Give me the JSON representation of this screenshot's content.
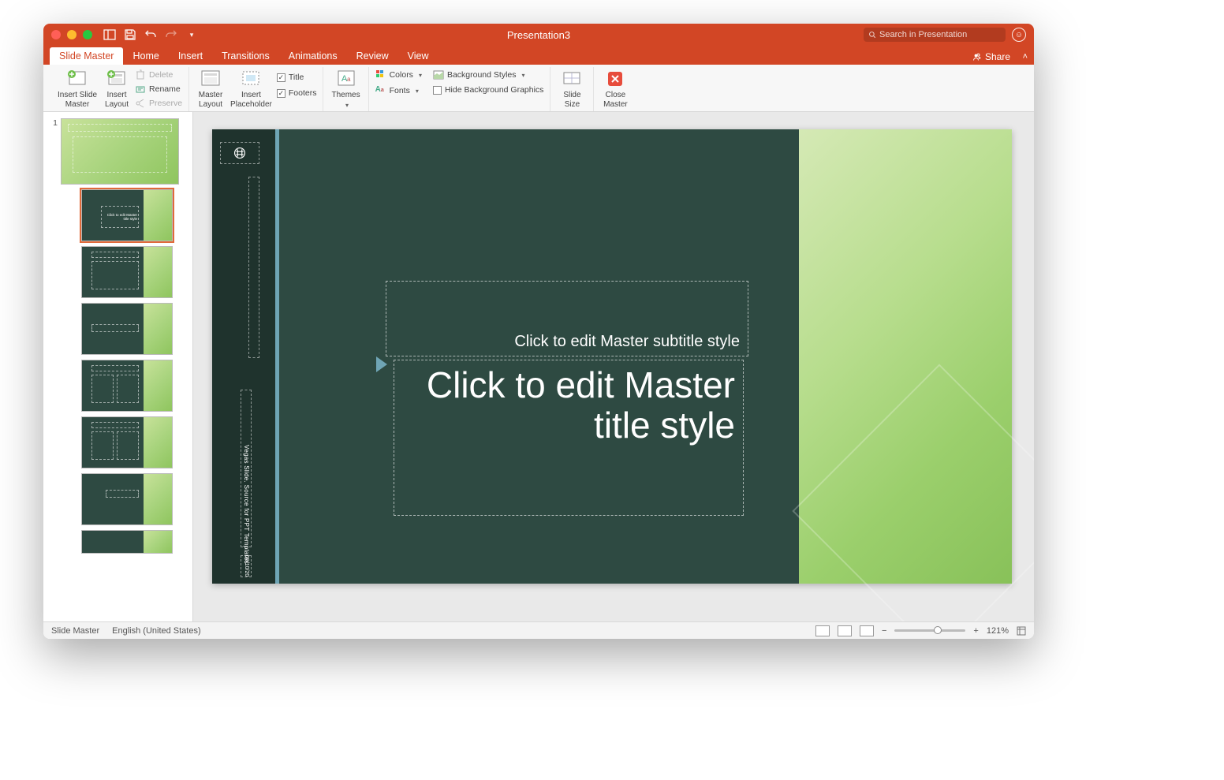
{
  "titlebar": {
    "document_title": "Presentation3",
    "search_placeholder": "Search in Presentation"
  },
  "tabs": {
    "items": [
      "Slide Master",
      "Home",
      "Insert",
      "Transitions",
      "Animations",
      "Review",
      "View"
    ],
    "active": "Slide Master",
    "share": "Share"
  },
  "ribbon": {
    "insert_slide_master": "Insert Slide\nMaster",
    "insert_layout": "Insert\nLayout",
    "delete": "Delete",
    "rename": "Rename",
    "preserve": "Preserve",
    "master_layout": "Master\nLayout",
    "insert_placeholder": "Insert\nPlaceholder",
    "title_chk": "Title",
    "footers_chk": "Footers",
    "themes": "Themes",
    "colors": "Colors",
    "fonts": "Fonts",
    "background_styles": "Background Styles",
    "hide_bg": "Hide Background Graphics",
    "slide_size": "Slide\nSize",
    "close_master": "Close\nMaster"
  },
  "thumbs": {
    "master_num": "1"
  },
  "slide": {
    "subtitle": "Click to edit Master subtitle style",
    "title": "Click to edit Master title style",
    "footer": "Vegas Slide. Source for PPT Templates",
    "date": "09/10/20"
  },
  "statusbar": {
    "mode": "Slide Master",
    "language": "English (United States)",
    "zoom": "121%",
    "minus": "−",
    "plus": "+"
  }
}
